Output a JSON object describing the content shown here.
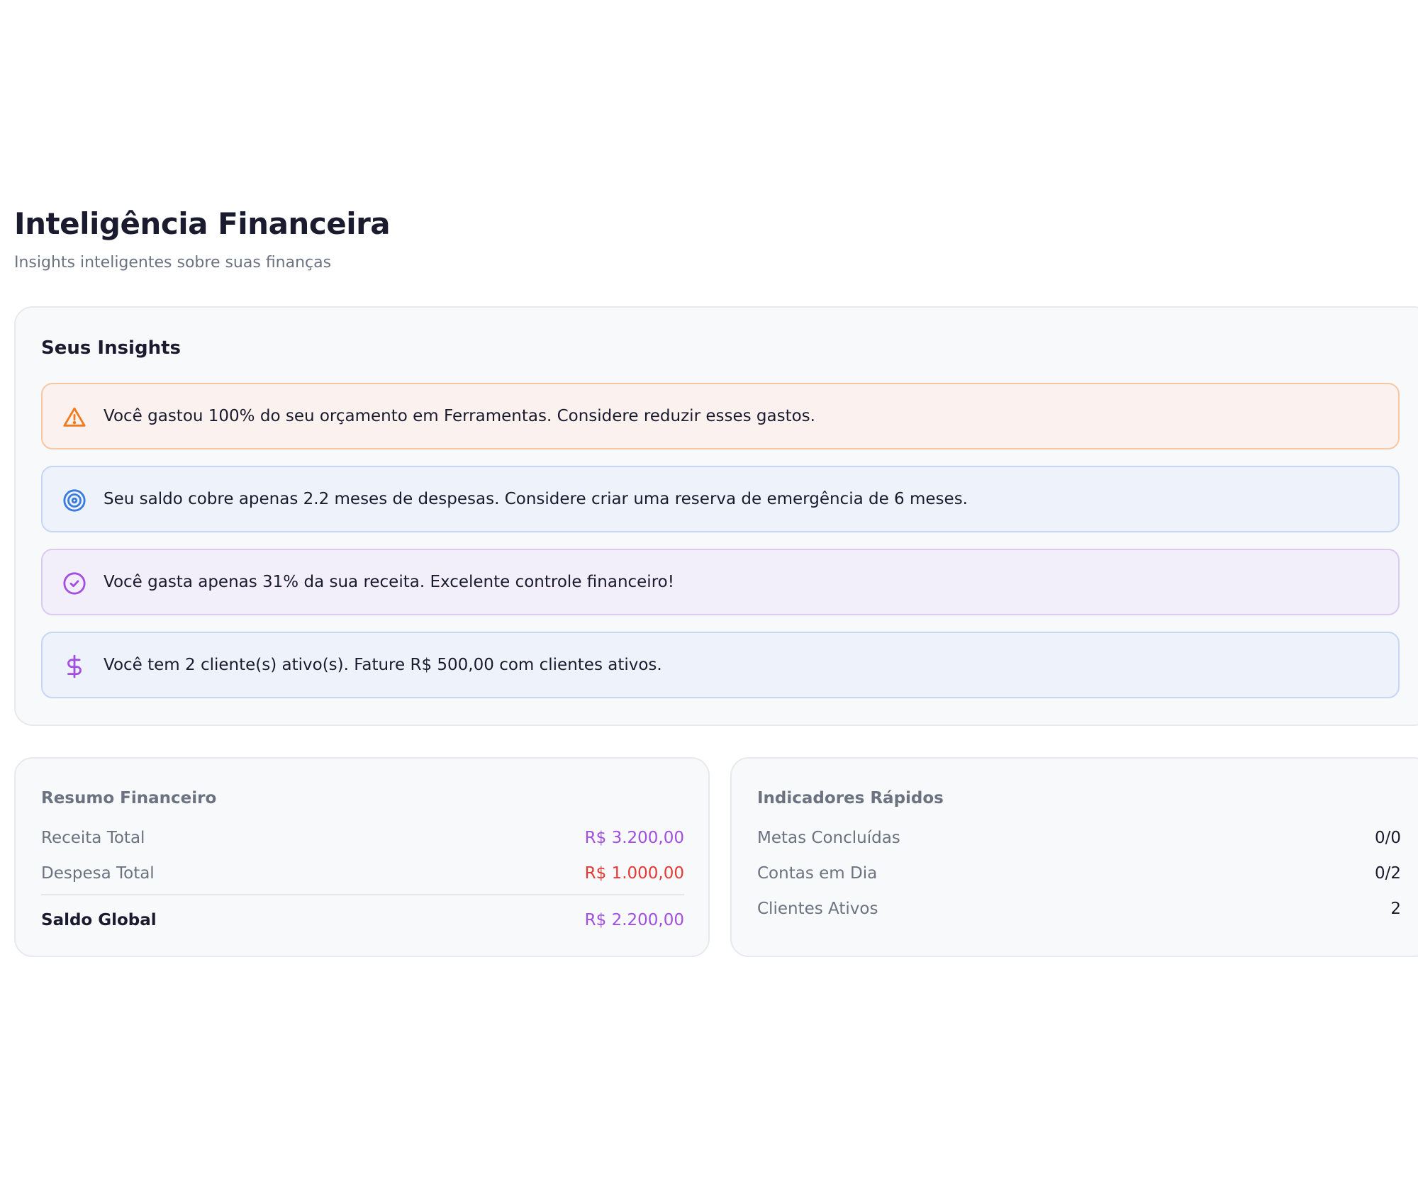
{
  "header": {
    "title": "Inteligência Financeira",
    "subtitle": "Insights inteligentes sobre suas finanças"
  },
  "insights": {
    "title": "Seus Insights",
    "items": [
      {
        "icon": "warning-icon",
        "text": "Você gastou 100% do seu orçamento em Ferramentas. Considere reduzir esses gastos."
      },
      {
        "icon": "target-icon",
        "text": "Seu saldo cobre apenas 2.2 meses de despesas. Considere criar uma reserva de emergência de 6 meses."
      },
      {
        "icon": "check-circle-icon",
        "text": "Você gasta apenas 31% da sua receita. Excelente controle financeiro!"
      },
      {
        "icon": "dollar-icon",
        "text": "Você tem 2 cliente(s) ativo(s). Fature R$ 500,00 com clientes ativos."
      }
    ]
  },
  "summary": {
    "title": "Resumo Financeiro",
    "rows": [
      {
        "label": "Receita Total",
        "value": "R$ 3.200,00"
      },
      {
        "label": "Despesa Total",
        "value": "R$ 1.000,00"
      },
      {
        "label": "Saldo Global",
        "value": "R$ 2.200,00"
      }
    ]
  },
  "indicators": {
    "title": "Indicadores Rápidos",
    "rows": [
      {
        "label": "Metas Concluídas",
        "value": "0/0"
      },
      {
        "label": "Contas em Dia",
        "value": "0/2"
      },
      {
        "label": "Clientes Ativos",
        "value": "2"
      }
    ]
  },
  "colors": {
    "accent_purple": "#a24fe0",
    "expense_red": "#e53935",
    "warning_orange": "#f07a1f",
    "target_blue": "#3a7be0",
    "text_dark": "#1a1b2e",
    "text_muted": "#6b7280"
  }
}
